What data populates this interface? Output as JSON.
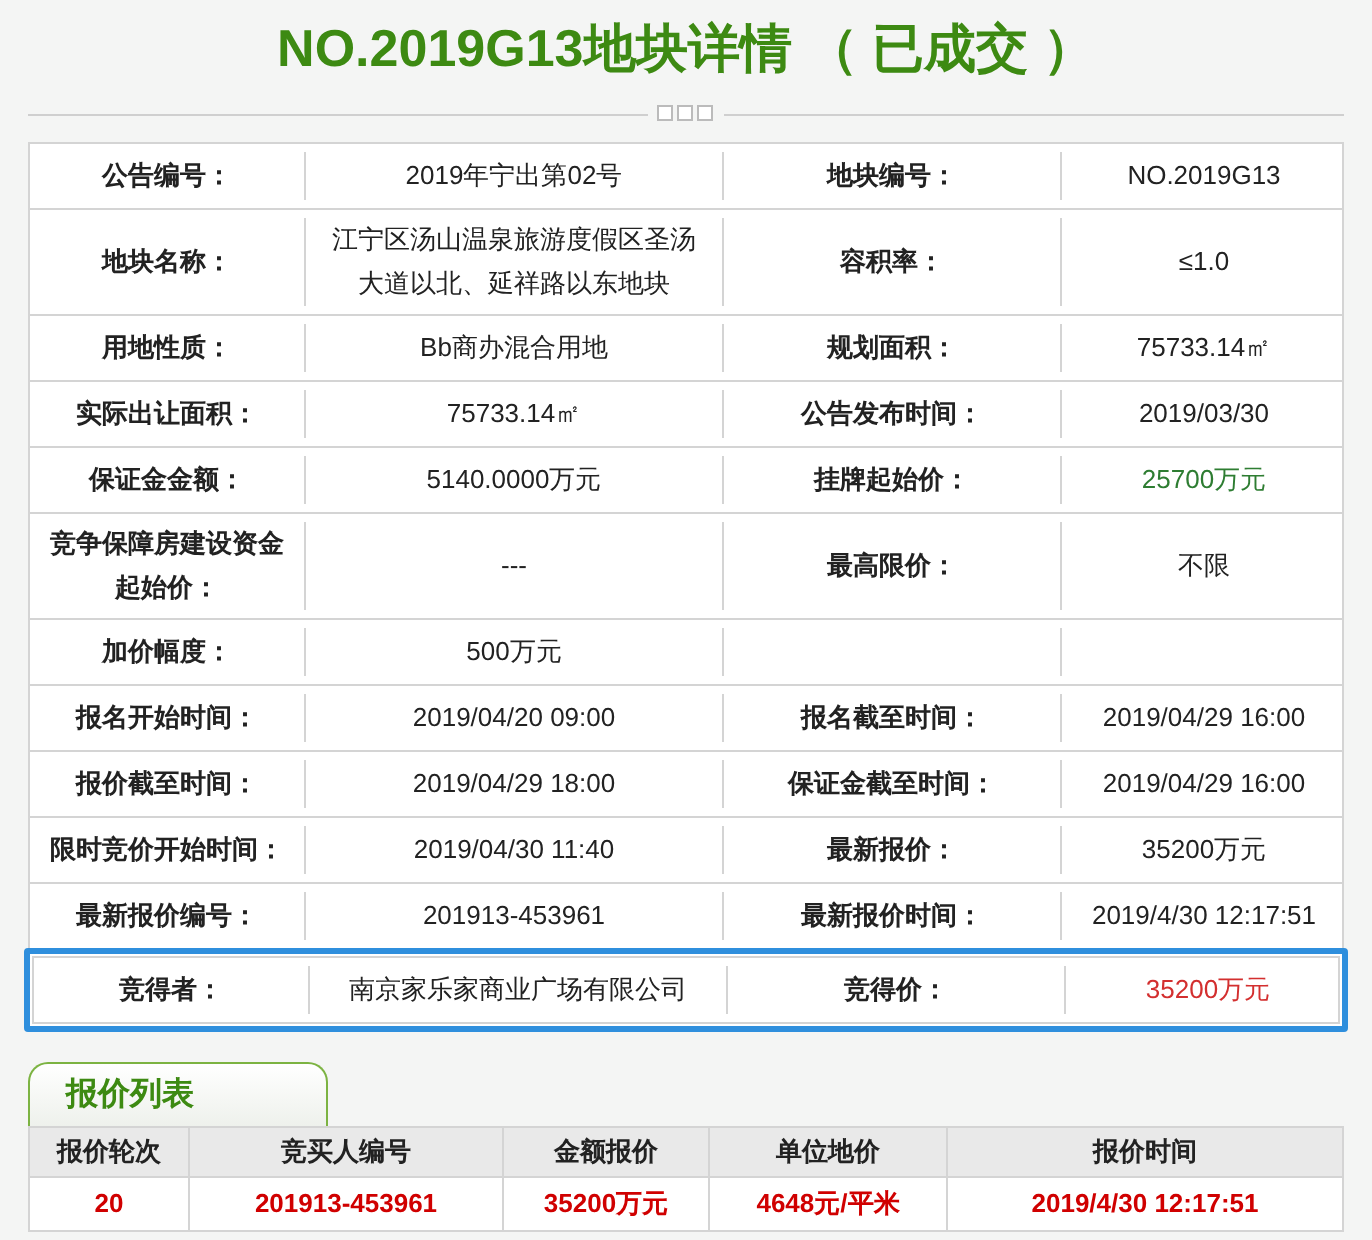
{
  "title": "NO.2019G13地块详情 （ 已成交 ）",
  "details": [
    {
      "cells": [
        {
          "label": "公告编号：",
          "value": "2019年宁出第02号"
        },
        {
          "label": "地块编号：",
          "value": "NO.2019G13"
        }
      ]
    },
    {
      "cells": [
        {
          "label": "地块名称：",
          "value": "江宁区汤山温泉旅游度假区圣汤大道以北、延祥路以东地块"
        },
        {
          "label": "容积率：",
          "value": "≤1.0"
        }
      ]
    },
    {
      "cells": [
        {
          "label": "用地性质：",
          "value": "Bb商办混合用地"
        },
        {
          "label": "规划面积：",
          "value": "75733.14㎡"
        }
      ]
    },
    {
      "cells": [
        {
          "label": "实际出让面积：",
          "value": "75733.14㎡"
        },
        {
          "label": "公告发布时间：",
          "value": "2019/03/30"
        }
      ]
    },
    {
      "cells": [
        {
          "label": "保证金金额：",
          "value": "5140.0000万元"
        },
        {
          "label": "挂牌起始价：",
          "value": "25700万元",
          "color": "#2e7d32"
        }
      ]
    },
    {
      "cells": [
        {
          "label": "竞争保障房建设资金起始价：",
          "value": "---"
        },
        {
          "label": "最高限价：",
          "value": "不限"
        }
      ]
    },
    {
      "cells": [
        {
          "label": "加价幅度：",
          "value": "500万元"
        }
      ]
    },
    {
      "cells": [
        {
          "label": "报名开始时间：",
          "value": "2019/04/20 09:00"
        },
        {
          "label": "报名截至时间：",
          "value": "2019/04/29 16:00"
        }
      ]
    },
    {
      "cells": [
        {
          "label": "报价截至时间：",
          "value": "2019/04/29 18:00"
        },
        {
          "label": "保证金截至时间：",
          "value": "2019/04/29 16:00"
        }
      ]
    },
    {
      "cells": [
        {
          "label": "限时竞价开始时间：",
          "value": "2019/04/30 11:40"
        },
        {
          "label": "最新报价：",
          "value": "35200万元"
        }
      ]
    },
    {
      "cells": [
        {
          "label": "最新报价编号：",
          "value": "201913-453961"
        },
        {
          "label": "最新报价时间：",
          "value": "2019/4/30 12:17:51"
        }
      ]
    }
  ],
  "winner": {
    "cells": [
      {
        "label": "竞得者：",
        "value": "南京家乐家商业广场有限公司"
      },
      {
        "label": "竞得价：",
        "value": "35200万元",
        "color": "#d32f2f"
      }
    ]
  },
  "bid_list": {
    "tab": "报价列表",
    "columns": [
      "报价轮次",
      "竞买人编号",
      "金额报价",
      "单位地价",
      "报价时间"
    ],
    "rows": [
      [
        "20",
        "201913-453961",
        "35200万元",
        "4648元/平米",
        "2019/4/30 12:17:51"
      ]
    ]
  }
}
